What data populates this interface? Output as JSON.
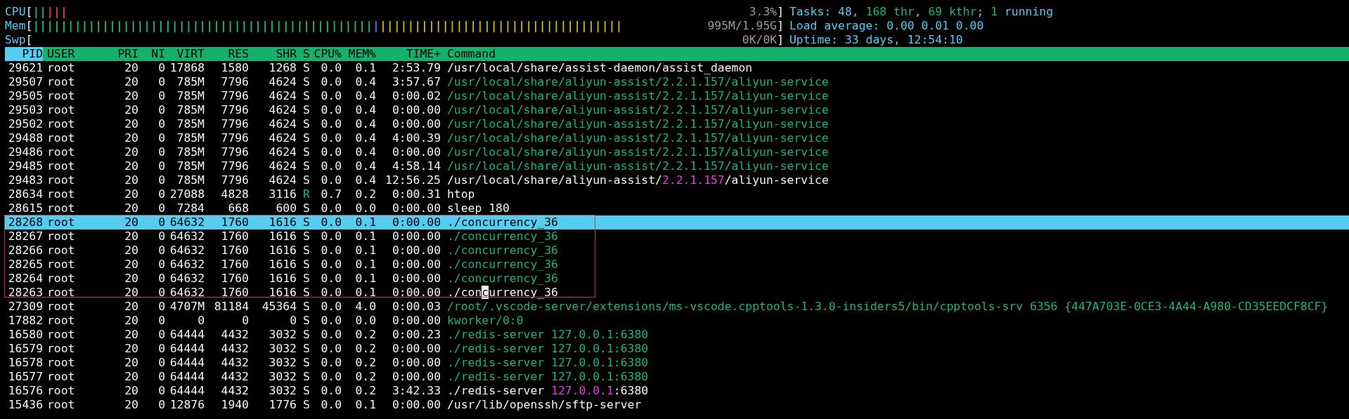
{
  "meters": [
    {
      "label": "CPU",
      "open": "[",
      "bars": [
        {
          "text": "||",
          "color": "#22b573"
        },
        {
          "text": "|||",
          "color": "#e03c3c"
        }
      ],
      "value": "3.3%",
      "close": "]"
    },
    {
      "label": "Mem",
      "open": "[",
      "bars": [
        {
          "text": "|||||||||||||||||||||||||||||||||||||||||||||||||",
          "color": "#22b573"
        },
        {
          "text": "|",
          "color": "#3b7bea"
        },
        {
          "text": "|||||||||||||||||||||||||||||||||||",
          "color": "#c8b418"
        }
      ],
      "value": "995M/1.95G",
      "close": "]"
    },
    {
      "label": "Swp",
      "open": "[",
      "value": "0K/0K",
      "close": "]"
    }
  ],
  "summary": [
    [
      {
        "text": "Tasks: 48, ",
        "kind": "label"
      },
      {
        "text": "168 thr",
        "kind": "count"
      },
      {
        "text": ", ",
        "kind": "label"
      },
      {
        "text": "69 kthr",
        "kind": "count"
      },
      {
        "text": "; ",
        "kind": "label"
      },
      {
        "text": "1",
        "kind": "count"
      },
      {
        "text": " running",
        "kind": "label"
      }
    ],
    [
      {
        "text": "Load average: ",
        "kind": "label"
      },
      {
        "text": "0.00",
        "kind": "current"
      },
      {
        "text": " 0.01 0.00",
        "kind": "label"
      }
    ],
    [
      {
        "text": "Uptime: 33 days, 12:54:10",
        "kind": "label"
      }
    ]
  ],
  "columns": [
    {
      "label": "PID",
      "selected": true
    },
    {
      "label": "USER",
      "selected": false
    },
    {
      "label": "PRI",
      "selected": false
    },
    {
      "label": "NI",
      "selected": false
    },
    {
      "label": "VIRT",
      "selected": false
    },
    {
      "label": "RES",
      "selected": false
    },
    {
      "label": "SHR",
      "selected": false
    },
    {
      "label": "S",
      "selected": false
    },
    {
      "label": "CPU%",
      "selected": false
    },
    {
      "label": "MEM%",
      "selected": false
    },
    {
      "label": "TIME+",
      "selected": false
    },
    {
      "label": "Command",
      "selected": false
    }
  ],
  "processes": [
    {
      "kind": "process",
      "cells": [
        "29621",
        "root",
        "20",
        "0",
        "17868",
        "1580",
        "1268",
        "S",
        "0.0",
        "0.1",
        "2:53.79"
      ],
      "running": false,
      "selected": false,
      "command": [
        {
          "text": "/usr/local/share/assist-daemon/assist_daemon",
          "kind": "process"
        }
      ]
    },
    {
      "kind": "process",
      "cells": [
        "29507",
        "root",
        "20",
        "0",
        "785M",
        "7796",
        "4624",
        "S",
        "0.0",
        "0.4",
        "3:57.67"
      ],
      "running": false,
      "selected": false,
      "command": [
        {
          "text": "/usr/local/share/aliyun-assist/2.2.1.157/aliyun-service",
          "kind": "thread"
        }
      ]
    },
    {
      "kind": "process",
      "cells": [
        "29505",
        "root",
        "20",
        "0",
        "785M",
        "7796",
        "4624",
        "S",
        "0.0",
        "0.4",
        "0:00.02"
      ],
      "running": false,
      "selected": false,
      "command": [
        {
          "text": "/usr/local/share/aliyun-assist/2.2.1.157/aliyun-service",
          "kind": "thread"
        }
      ]
    },
    {
      "kind": "process",
      "cells": [
        "29503",
        "root",
        "20",
        "0",
        "785M",
        "7796",
        "4624",
        "S",
        "0.0",
        "0.4",
        "0:00.00"
      ],
      "running": false,
      "selected": false,
      "command": [
        {
          "text": "/usr/local/share/aliyun-assist/2.2.1.157/aliyun-service",
          "kind": "thread"
        }
      ]
    },
    {
      "kind": "process",
      "cells": [
        "29502",
        "root",
        "20",
        "0",
        "785M",
        "7796",
        "4624",
        "S",
        "0.0",
        "0.4",
        "0:00.00"
      ],
      "running": false,
      "selected": false,
      "command": [
        {
          "text": "/usr/local/share/aliyun-assist/2.2.1.157/aliyun-service",
          "kind": "thread"
        }
      ]
    },
    {
      "kind": "process",
      "cells": [
        "29488",
        "root",
        "20",
        "0",
        "785M",
        "7796",
        "4624",
        "S",
        "0.0",
        "0.4",
        "4:00.39"
      ],
      "running": false,
      "selected": false,
      "command": [
        {
          "text": "/usr/local/share/aliyun-assist/2.2.1.157/aliyun-service",
          "kind": "thread"
        }
      ]
    },
    {
      "kind": "process",
      "cells": [
        "29486",
        "root",
        "20",
        "0",
        "785M",
        "7796",
        "4624",
        "S",
        "0.0",
        "0.4",
        "0:00.00"
      ],
      "running": false,
      "selected": false,
      "command": [
        {
          "text": "/usr/local/share/aliyun-assist/2.2.1.157/aliyun-service",
          "kind": "thread"
        }
      ]
    },
    {
      "kind": "process",
      "cells": [
        "29485",
        "root",
        "20",
        "0",
        "785M",
        "7796",
        "4624",
        "S",
        "0.0",
        "0.4",
        "4:58.14"
      ],
      "running": false,
      "selected": false,
      "command": [
        {
          "text": "/usr/local/share/aliyun-assist/2.2.1.157/aliyun-service",
          "kind": "thread"
        }
      ]
    },
    {
      "kind": "process",
      "cells": [
        "29483",
        "root",
        "20",
        "0",
        "785M",
        "7796",
        "4624",
        "S",
        "0.0",
        "0.4",
        "12:56.25"
      ],
      "running": false,
      "selected": false,
      "command": [
        {
          "text": "/usr/local/share/aliyun-assist/",
          "kind": "process"
        },
        {
          "text": "2.2.1.157",
          "kind": "match"
        },
        {
          "text": "/aliyun-service",
          "kind": "process"
        }
      ]
    },
    {
      "kind": "process",
      "cells": [
        "28634",
        "root",
        "20",
        "0",
        "27088",
        "4828",
        "3116",
        "R",
        "0.7",
        "0.2",
        "0:00.31"
      ],
      "running": true,
      "selected": false,
      "command": [
        {
          "text": "htop",
          "kind": "process"
        }
      ]
    },
    {
      "kind": "process",
      "cells": [
        "28615",
        "root",
        "20",
        "0",
        "7284",
        "668",
        "600",
        "S",
        "0.0",
        "0.0",
        "0:00.00"
      ],
      "running": false,
      "selected": false,
      "command": [
        {
          "text": "sleep 180",
          "kind": "process"
        }
      ]
    },
    {
      "kind": "annotation_frame",
      "rows": [
        {
          "cells": [
            "28268",
            "root",
            "20",
            "0",
            "64632",
            "1760",
            "1616",
            "S",
            "0.0",
            "0.1",
            "0:00.00"
          ],
          "running": false,
          "selected": true,
          "command": [
            {
              "text": "./concurrency_36",
              "kind": "process"
            }
          ]
        },
        {
          "cells": [
            "28267",
            "root",
            "20",
            "0",
            "64632",
            "1760",
            "1616",
            "S",
            "0.0",
            "0.1",
            "0:00.00"
          ],
          "running": false,
          "selected": false,
          "command": [
            {
              "text": "./concurrency_36",
              "kind": "thread"
            }
          ]
        },
        {
          "cells": [
            "28266",
            "root",
            "20",
            "0",
            "64632",
            "1760",
            "1616",
            "S",
            "0.0",
            "0.1",
            "0:00.00"
          ],
          "running": false,
          "selected": false,
          "command": [
            {
              "text": "./concurrency_36",
              "kind": "thread"
            }
          ]
        },
        {
          "cells": [
            "28265",
            "root",
            "20",
            "0",
            "64632",
            "1760",
            "1616",
            "S",
            "0.0",
            "0.1",
            "0:00.00"
          ],
          "running": false,
          "selected": false,
          "command": [
            {
              "text": "./concurrency_36",
              "kind": "thread"
            }
          ]
        },
        {
          "cells": [
            "28264",
            "root",
            "20",
            "0",
            "64632",
            "1760",
            "1616",
            "S",
            "0.0",
            "0.1",
            "0:00.00"
          ],
          "running": false,
          "selected": false,
          "command": [
            {
              "text": "./concurrency_36",
              "kind": "thread"
            }
          ]
        },
        {
          "cells": [
            "28263",
            "root",
            "20",
            "0",
            "64632",
            "1760",
            "1616",
            "S",
            "0.0",
            "0.1",
            "0:00.00"
          ],
          "running": false,
          "selected": false,
          "command": [
            {
              "text": "./con",
              "kind": "process"
            },
            {
              "text": "c",
              "kind": "cursor"
            },
            {
              "text": "urrency_36",
              "kind": "process"
            }
          ]
        }
      ]
    },
    {
      "kind": "process",
      "cells": [
        "27309",
        "root",
        "20",
        "0",
        "4707M",
        "81184",
        "45364",
        "S",
        "0.0",
        "4.0",
        "0:00.03"
      ],
      "running": false,
      "selected": false,
      "command": [
        {
          "text": "/root/.vscode-server/extensions/ms-vscode.cpptools-1.3.0-insiders5/bin/cpptools-srv 6356 {447A703E-0CE3-4A44-A980-CD35EEDCF8CF}",
          "kind": "thread"
        }
      ]
    },
    {
      "kind": "process",
      "cells": [
        "17882",
        "root",
        "20",
        "0",
        "0",
        "0",
        "0",
        "S",
        "0.0",
        "0.0",
        "0:00.00"
      ],
      "running": false,
      "selected": false,
      "command": [
        {
          "text": "kworker/0:0",
          "kind": "thread"
        }
      ]
    },
    {
      "kind": "process",
      "cells": [
        "16580",
        "root",
        "20",
        "0",
        "64444",
        "4432",
        "3032",
        "S",
        "0.0",
        "0.2",
        "0:00.23"
      ],
      "running": false,
      "selected": false,
      "command": [
        {
          "text": "./redis-server 127.0.0.1:6380",
          "kind": "thread"
        }
      ]
    },
    {
      "kind": "process",
      "cells": [
        "16579",
        "root",
        "20",
        "0",
        "64444",
        "4432",
        "3032",
        "S",
        "0.0",
        "0.2",
        "0:00.00"
      ],
      "running": false,
      "selected": false,
      "command": [
        {
          "text": "./redis-server 127.0.0.1:6380",
          "kind": "thread"
        }
      ]
    },
    {
      "kind": "process",
      "cells": [
        "16578",
        "root",
        "20",
        "0",
        "64444",
        "4432",
        "3032",
        "S",
        "0.0",
        "0.2",
        "0:00.00"
      ],
      "running": false,
      "selected": false,
      "command": [
        {
          "text": "./redis-server 127.0.0.1:6380",
          "kind": "thread"
        }
      ]
    },
    {
      "kind": "process",
      "cells": [
        "16577",
        "root",
        "20",
        "0",
        "64444",
        "4432",
        "3032",
        "S",
        "0.0",
        "0.2",
        "0:00.00"
      ],
      "running": false,
      "selected": false,
      "command": [
        {
          "text": "./redis-server 127.0.0.1:6380",
          "kind": "thread"
        }
      ]
    },
    {
      "kind": "process",
      "cells": [
        "16576",
        "root",
        "20",
        "0",
        "64444",
        "4432",
        "3032",
        "S",
        "0.0",
        "0.2",
        "3:42.33"
      ],
      "running": false,
      "selected": false,
      "command": [
        {
          "text": "./redis-server ",
          "kind": "process"
        },
        {
          "text": "127.0.0.1",
          "kind": "match"
        },
        {
          "text": ":6380",
          "kind": "process"
        }
      ]
    },
    {
      "kind": "process",
      "cells": [
        "15436",
        "root",
        "20",
        "0",
        "12876",
        "1940",
        "1776",
        "S",
        "0.0",
        "0.1",
        "0:00.00"
      ],
      "running": false,
      "selected": false,
      "command": [
        {
          "text": "/usr/lib/openssh/sftp-server",
          "kind": "process"
        }
      ]
    }
  ]
}
